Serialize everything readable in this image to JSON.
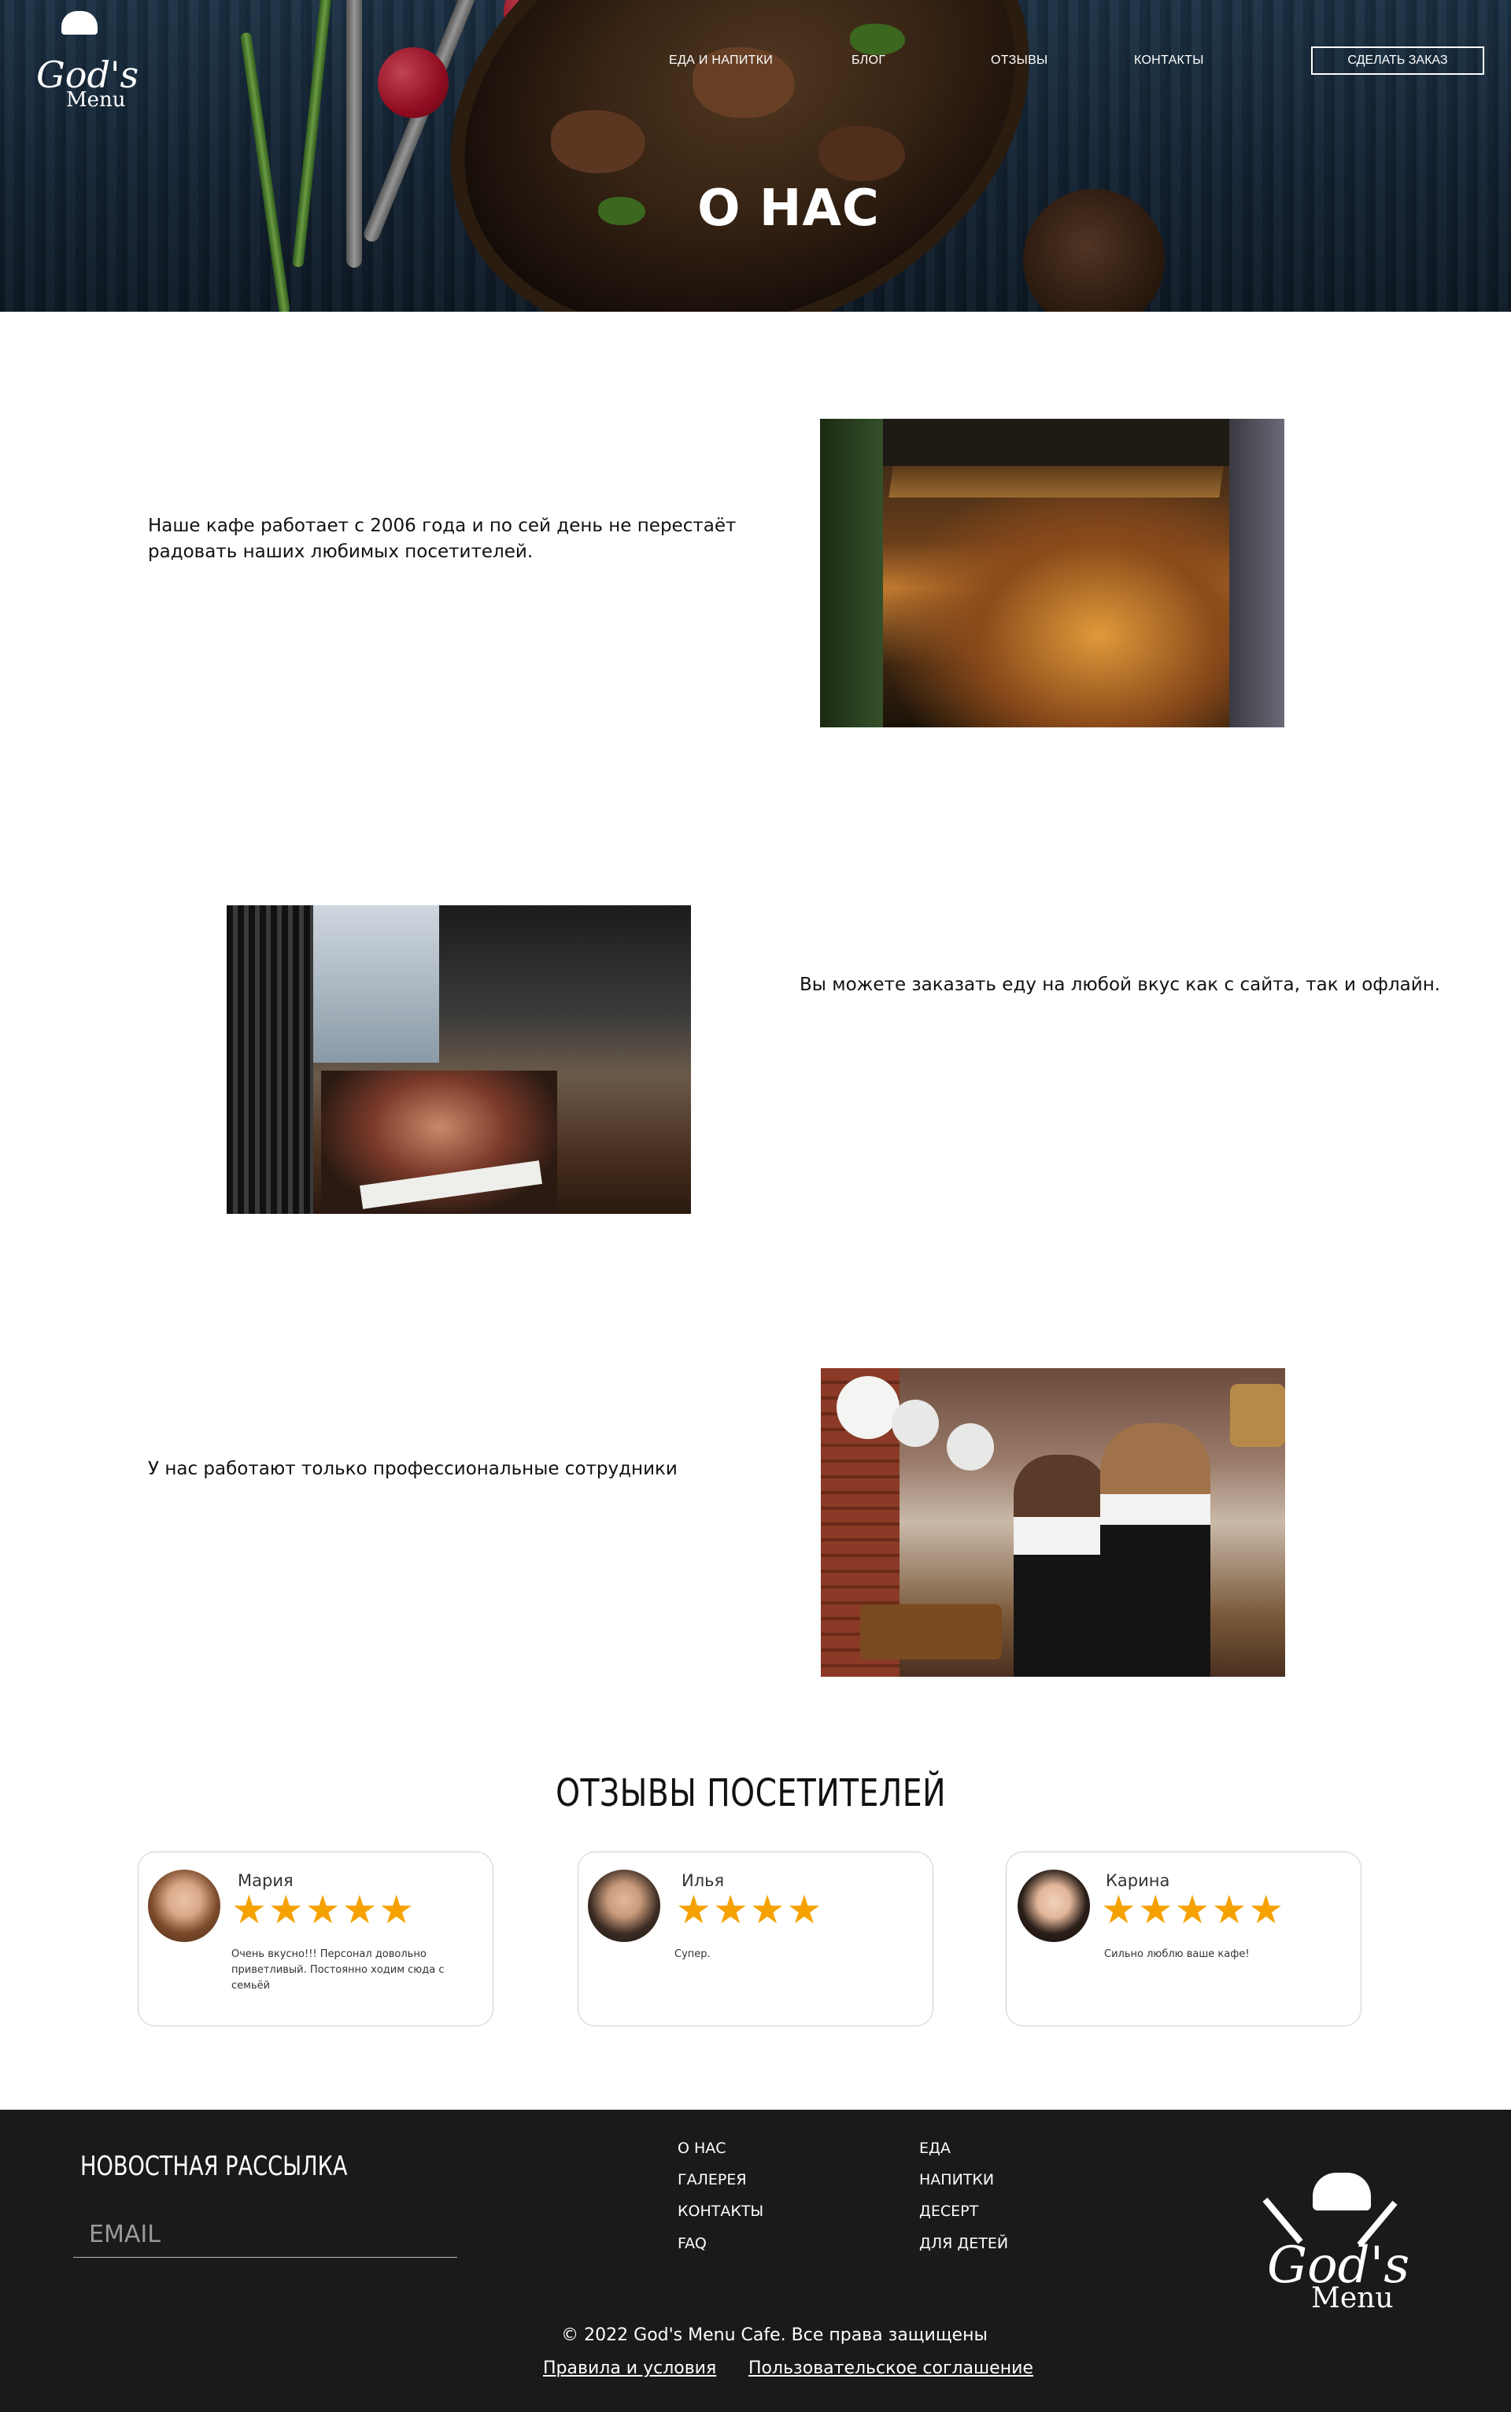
{
  "header": {
    "logo": {
      "script": "God's",
      "word": "Menu"
    },
    "nav": [
      {
        "label": "ЕДА И НАПИТКИ"
      },
      {
        "label": "БЛОГ"
      },
      {
        "label": "ОТЗЫВЫ"
      },
      {
        "label": "КОНТАКТЫ"
      }
    ],
    "order_button": "СДЕЛАТЬ ЗАКАЗ",
    "title": "О НАС"
  },
  "about": [
    {
      "text": "Наше кафе работает с 2006 года и по сей день не перестаёт радовать наших любимых посетителей."
    },
    {
      "text": "Вы можете заказать еду на любой вкус как с сайта, так и офлайн."
    },
    {
      "text": "У нас работают только профессиональные сотрудники"
    }
  ],
  "reviews": {
    "title": "ОТЗЫВЫ ПОСЕТИТЕЛЕЙ",
    "items": [
      {
        "name": "Мария",
        "rating": 5,
        "stars": "★★★★★",
        "text": "Очень вкусно!!! Персонал довольно приветливый. Постоянно ходим сюда с семьёй"
      },
      {
        "name": "Илья",
        "rating": 4,
        "stars": "★★★★",
        "text": "Супер."
      },
      {
        "name": "Карина",
        "rating": 5,
        "stars": "★★★★★",
        "text": "Сильно люблю ваше кафе!"
      }
    ]
  },
  "footer": {
    "newsletter_title": "НОВОСТНАЯ РАССЫЛКА",
    "email_placeholder": "EMAIL",
    "links_col1": [
      "О НАС",
      "ГАЛЕРЕЯ",
      "КОНТАКТЫ",
      "FAQ"
    ],
    "links_col2": [
      "ЕДА",
      "НАПИТКИ",
      "ДЕСЕРТ",
      "ДЛЯ ДЕТЕЙ"
    ],
    "logo": {
      "script": "God's",
      "word": "Menu"
    },
    "copyright": "© 2022 God's Menu Cafe. Все права защищены",
    "terms": "Правила и условия",
    "agreement": "Пользовательское соглашение"
  },
  "colors": {
    "star": "#f5a200",
    "footer_bg": "#1a1a1a",
    "hero_bg": "#1e3650"
  }
}
